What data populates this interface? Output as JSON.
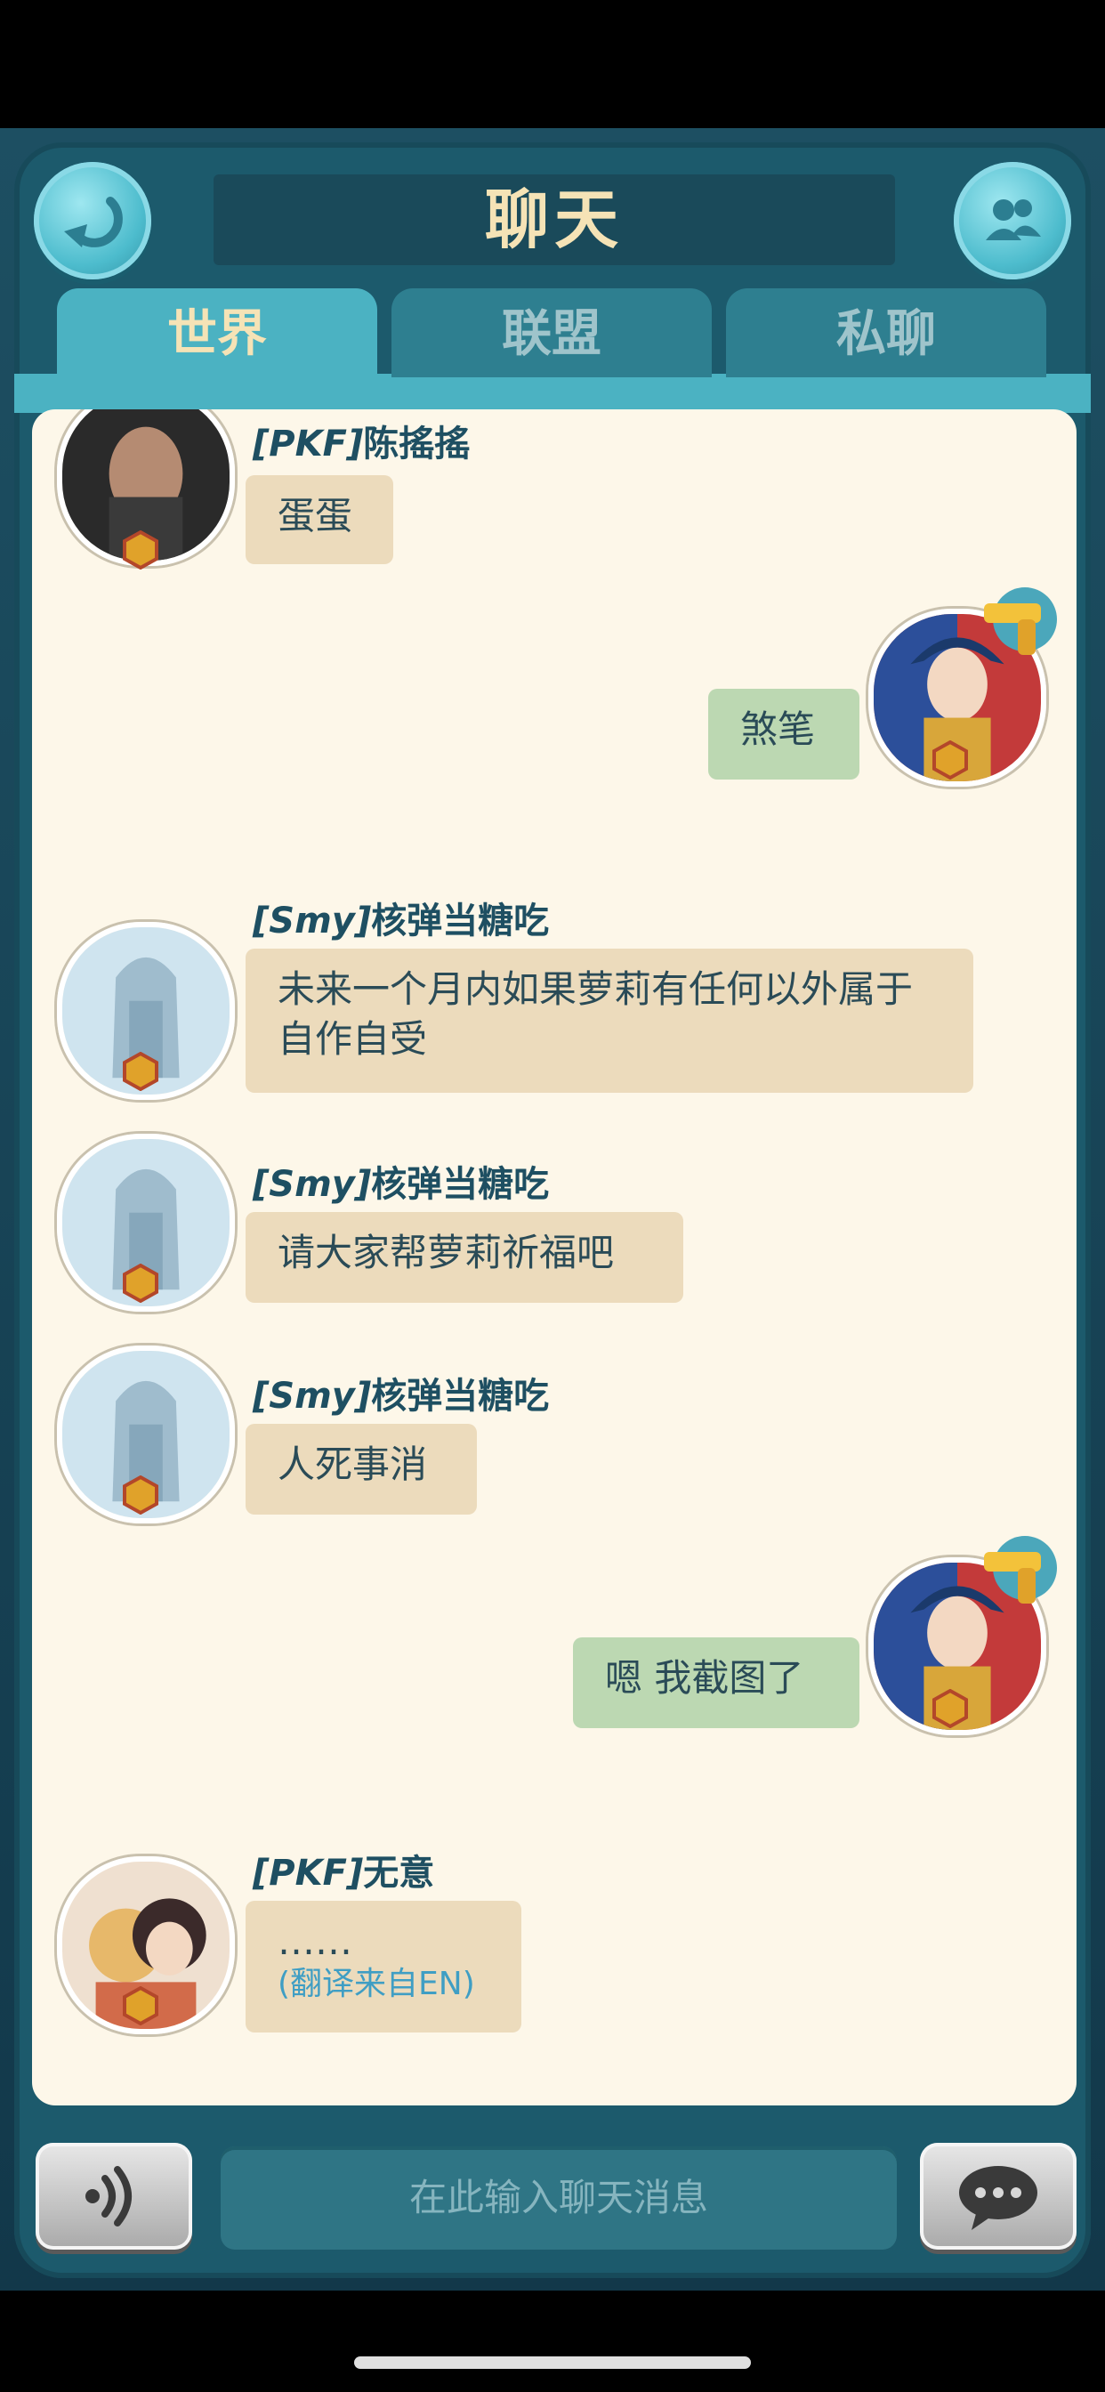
{
  "header": {
    "title": "聊天"
  },
  "tabs": [
    {
      "label": "世界",
      "active": true
    },
    {
      "label": "联盟",
      "active": false
    },
    {
      "label": "私聊",
      "active": false
    }
  ],
  "messages": [
    {
      "side": "left",
      "tag": "[PKF]",
      "name": "陈搖搖",
      "text": "蛋蛋"
    },
    {
      "side": "right",
      "text": "煞笔"
    },
    {
      "side": "left",
      "tag": "[Smy]",
      "name": "核弹当糖吃",
      "text": "未来一个月内如果萝莉有任何以外属于自作自受"
    },
    {
      "side": "left",
      "tag": "[Smy]",
      "name": "核弹当糖吃",
      "text": "请大家帮萝莉祈福吧"
    },
    {
      "side": "left",
      "tag": "[Smy]",
      "name": "核弹当糖吃",
      "text": "人死事消"
    },
    {
      "side": "right",
      "text": "嗯 我截图了"
    },
    {
      "side": "left",
      "tag": "[PKF]",
      "name": "无意",
      "text": "……",
      "translation": "(翻译来自EN)"
    }
  ],
  "input": {
    "placeholder": "在此输入聊天消息"
  },
  "colors": {
    "accent": "#4bb2c2",
    "title_text": "#f5e3b6",
    "bubble_left": "#ecdbbc",
    "bubble_right": "#bcd8b2",
    "name_text": "#1e4f62"
  },
  "icons": {
    "back": "back-arrow-icon",
    "friends": "friends-icon",
    "voice": "voice-icon",
    "send": "chat-bubble-icon",
    "rank": "rank-badge-icon",
    "gun": "golden-gun-icon"
  }
}
